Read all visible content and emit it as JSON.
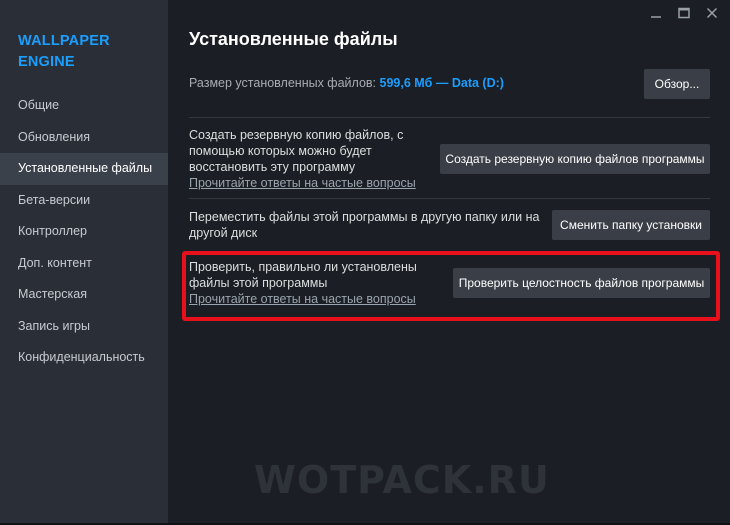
{
  "app": {
    "title": "WALLPAPER ENGINE"
  },
  "sidebar": {
    "items": [
      {
        "label": "Общие"
      },
      {
        "label": "Обновления"
      },
      {
        "label": "Установленные файлы",
        "active": true
      },
      {
        "label": "Бета-версии"
      },
      {
        "label": "Контроллер"
      },
      {
        "label": "Доп. контент"
      },
      {
        "label": "Мастерская"
      },
      {
        "label": "Запись игры"
      },
      {
        "label": "Конфиденциальность"
      }
    ]
  },
  "window_controls": {
    "minimize": "minimize-icon",
    "maximize": "maximize-icon",
    "close": "close-icon"
  },
  "main": {
    "title": "Установленные файлы",
    "size_label": "Размер установленных файлов:",
    "size_value": "599,6 Мб — Data (D:)",
    "browse_button": "Обзор...",
    "backup": {
      "text": "Создать резервную копию файлов, с помощью которых можно будет восстановить эту программу",
      "link": "Прочитайте ответы на частые вопросы",
      "button": "Создать резервную копию файлов программы"
    },
    "move": {
      "text": "Переместить файлы этой программы в другую папку или на другой диск",
      "button": "Сменить папку установки"
    },
    "verify": {
      "text": "Проверить, правильно ли установлены файлы этой программы",
      "link": "Прочитайте ответы на частые вопросы",
      "button": "Проверить целостность файлов программы"
    }
  },
  "watermark": "WOTPACK.RU",
  "colors": {
    "accent": "#1a9fff",
    "highlight": "#e8101a",
    "background": "#1b1e24",
    "sidebar": "#2a2e36"
  }
}
